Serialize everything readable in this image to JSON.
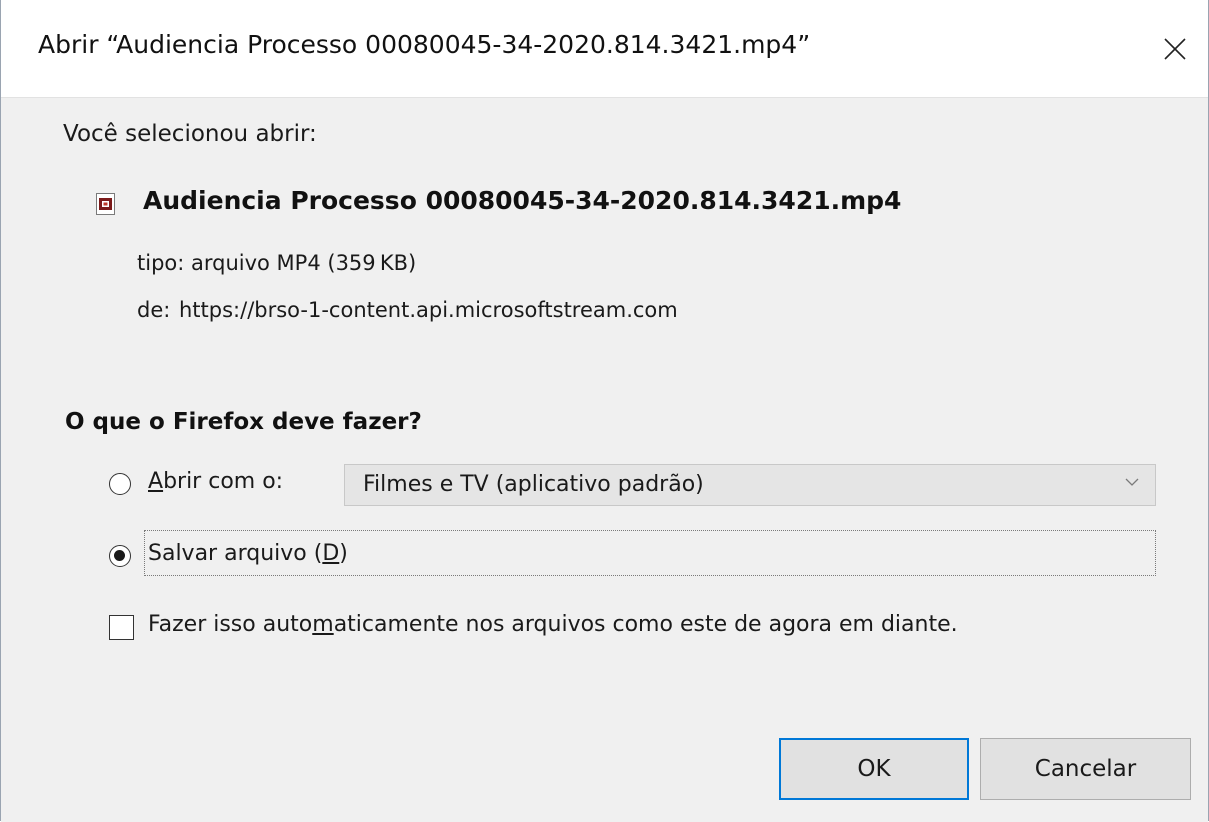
{
  "dialog": {
    "title": "Abrir “Audiencia Processo 00080045-34-2020.814.3421.mp4”"
  },
  "file": {
    "selected_label": "Você selecionou abrir:",
    "name": "Audiencia Processo 00080045-34-2020.814.3421.mp4",
    "type_text": "tipo: arquivo MP4 (359 KB)",
    "from_label": "de:",
    "from_url": "https://brso-1-content.api.microsoftstream.com",
    "icon": "video-file-icon"
  },
  "action": {
    "question": "O que o Firefox deve fazer?",
    "open_with": {
      "accel": "A",
      "rest": "brir com o:",
      "checked": false
    },
    "open_app": "Filmes e TV (aplicativo padrão)",
    "save": {
      "prefix": "Salvar arquivo (",
      "accel": "D",
      "suffix": ")",
      "checked": true
    },
    "auto": {
      "prefix": "Fazer isso auto",
      "accel": "m",
      "suffix": "aticamente nos arquivos como este de agora em diante.",
      "checked": false
    }
  },
  "buttons": {
    "ok": "OK",
    "cancel": "Cancelar"
  },
  "colors": {
    "accent": "#0078d7",
    "content_bg": "#f0f0f0",
    "button_bg": "#e1e1e1"
  }
}
